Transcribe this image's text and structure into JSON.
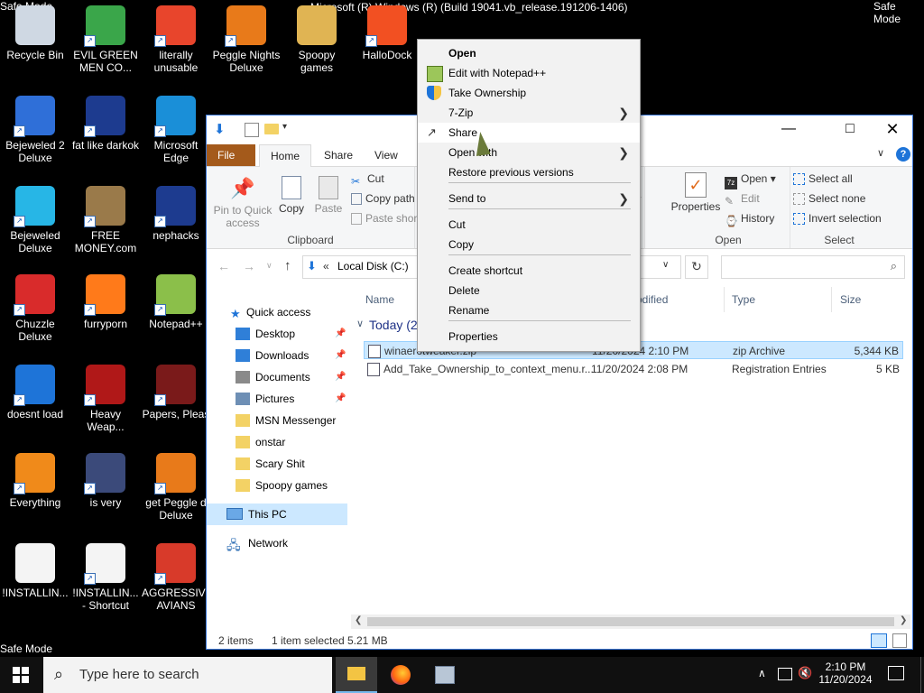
{
  "screen": {
    "safe_mode_label": "Safe Mode",
    "build_info": "Microsoft (R) Windows (R) (Build 19041.vb_release.191206-1406)"
  },
  "desktop_icons": [
    {
      "label": "Recycle Bin",
      "color": "#cfd8e3",
      "shortcut": false
    },
    {
      "label": "EVIL GREEN MEN CO...",
      "color": "#3aa64a",
      "shortcut": true
    },
    {
      "label": "literally unusable",
      "color": "#e8452c",
      "shortcut": true
    },
    {
      "label": "Peggle Nights Deluxe",
      "color": "#e87a1a",
      "shortcut": true
    },
    {
      "label": "Spoopy games",
      "color": "#e0b453",
      "shortcut": false
    },
    {
      "label": "HalloDock",
      "color": "#f25022",
      "shortcut": true
    },
    {
      "label": "Bejeweled 2 Deluxe",
      "color": "#2f6fd8",
      "shortcut": true
    },
    {
      "label": "fat like darkok",
      "color": "#1d3b8f",
      "shortcut": true
    },
    {
      "label": "Microsoft Edge",
      "color": "#1a8fd8",
      "shortcut": true
    },
    {
      "label": "Bejeweled Deluxe",
      "color": "#27b6e6",
      "shortcut": true
    },
    {
      "label": "FREE MONEY.com",
      "color": "#9a7a4a",
      "shortcut": true
    },
    {
      "label": "nephacks",
      "color": "#1d3b8f",
      "shortcut": true
    },
    {
      "label": "Chuzzle Deluxe",
      "color": "#d92b2b",
      "shortcut": true
    },
    {
      "label": "furryporn",
      "color": "#ff7a1a",
      "shortcut": true
    },
    {
      "label": "Notepad++",
      "color": "#8bbf4a",
      "shortcut": true
    },
    {
      "label": "doesnt load",
      "color": "#1e74d8",
      "shortcut": true
    },
    {
      "label": "Heavy Weap...",
      "color": "#b01818",
      "shortcut": true
    },
    {
      "label": "Papers, Pleas",
      "color": "#7a1a1a",
      "shortcut": true
    },
    {
      "label": "Everything",
      "color": "#f08a1a",
      "shortcut": true
    },
    {
      "label": "is very",
      "color": "#3b4a7a",
      "shortcut": true
    },
    {
      "label": "get Peggle d Deluxe",
      "color": "#e87a1a",
      "shortcut": true
    },
    {
      "label": "!INSTALLIN...",
      "color": "#f4f4f4",
      "shortcut": false
    },
    {
      "label": "!INSTALLIN... - Shortcut",
      "color": "#f4f4f4",
      "shortcut": true
    },
    {
      "label": "AGGRESSIVE AVIANS",
      "color": "#d83a2a",
      "shortcut": true
    }
  ],
  "explorer": {
    "tabs": {
      "file": "File",
      "home": "Home",
      "share": "Share",
      "view": "View"
    },
    "ribbon": {
      "pin": "Pin to Quick access",
      "copy": "Copy",
      "paste": "Paste",
      "cut": "Cut",
      "copy_path": "Copy path",
      "paste_shortcut": "Paste short",
      "clipboard_label": "Clipboard",
      "properties": "Properties",
      "open": "Open",
      "edit": "Edit",
      "history": "History",
      "open_label": "Open",
      "select_all": "Select all",
      "select_none": "Select none",
      "invert_selection": "Invert selection",
      "select_label": "Select"
    },
    "address": {
      "path": "Local Disk (C:)",
      "prefix": "«"
    },
    "nav": {
      "quick_access": "Quick access",
      "items": [
        {
          "label": "Desktop",
          "pinned": true
        },
        {
          "label": "Downloads",
          "pinned": true
        },
        {
          "label": "Documents",
          "pinned": true
        },
        {
          "label": "Pictures",
          "pinned": true
        },
        {
          "label": "MSN Messenger",
          "pinned": false
        },
        {
          "label": "onstar",
          "pinned": false
        },
        {
          "label": "Scary Shit",
          "pinned": false
        },
        {
          "label": "Spoopy games",
          "pinned": false
        }
      ],
      "this_pc": "This PC",
      "network": "Network"
    },
    "columns": {
      "name": "Name",
      "modified": "odified",
      "type": "Type",
      "size": "Size"
    },
    "group": "Today (2",
    "files": [
      {
        "name": "winaerotweaker.zip",
        "modified": "11/20/2024 2:10 PM",
        "type": "zip Archive",
        "size": "5,344 KB",
        "selected": true
      },
      {
        "name": "Add_Take_Ownership_to_context_menu.r...",
        "modified": "11/20/2024 2:08 PM",
        "type": "Registration Entries",
        "size": "5 KB",
        "selected": false
      }
    ],
    "status": {
      "count": "2 items",
      "selected": "1 item selected",
      "size": "5.21 MB"
    }
  },
  "context_menu": {
    "items": [
      {
        "label": "Open",
        "bold": true
      },
      {
        "label": "Edit with Notepad++",
        "icon": "notepad-icon"
      },
      {
        "label": "Take Ownership",
        "icon": "shield-icon"
      },
      {
        "label": "7-Zip",
        "submenu": true
      },
      {
        "label": "Share",
        "icon": "share-icon",
        "highlighted": true
      },
      {
        "label": "Open with",
        "submenu": true
      },
      {
        "label": "Restore previous versions"
      },
      {
        "label": "Send to",
        "submenu": true
      },
      {
        "label": "Cut"
      },
      {
        "label": "Copy"
      },
      {
        "label": "Create shortcut"
      },
      {
        "label": "Delete"
      },
      {
        "label": "Rename"
      },
      {
        "label": "Properties"
      }
    ]
  },
  "taskbar": {
    "search_placeholder": "Type here to search",
    "time": "2:10 PM",
    "date": "11/20/2024"
  },
  "colors": {
    "accent": "#0078d7",
    "file_tab": "#a45a1b",
    "selection": "#cce8ff"
  }
}
